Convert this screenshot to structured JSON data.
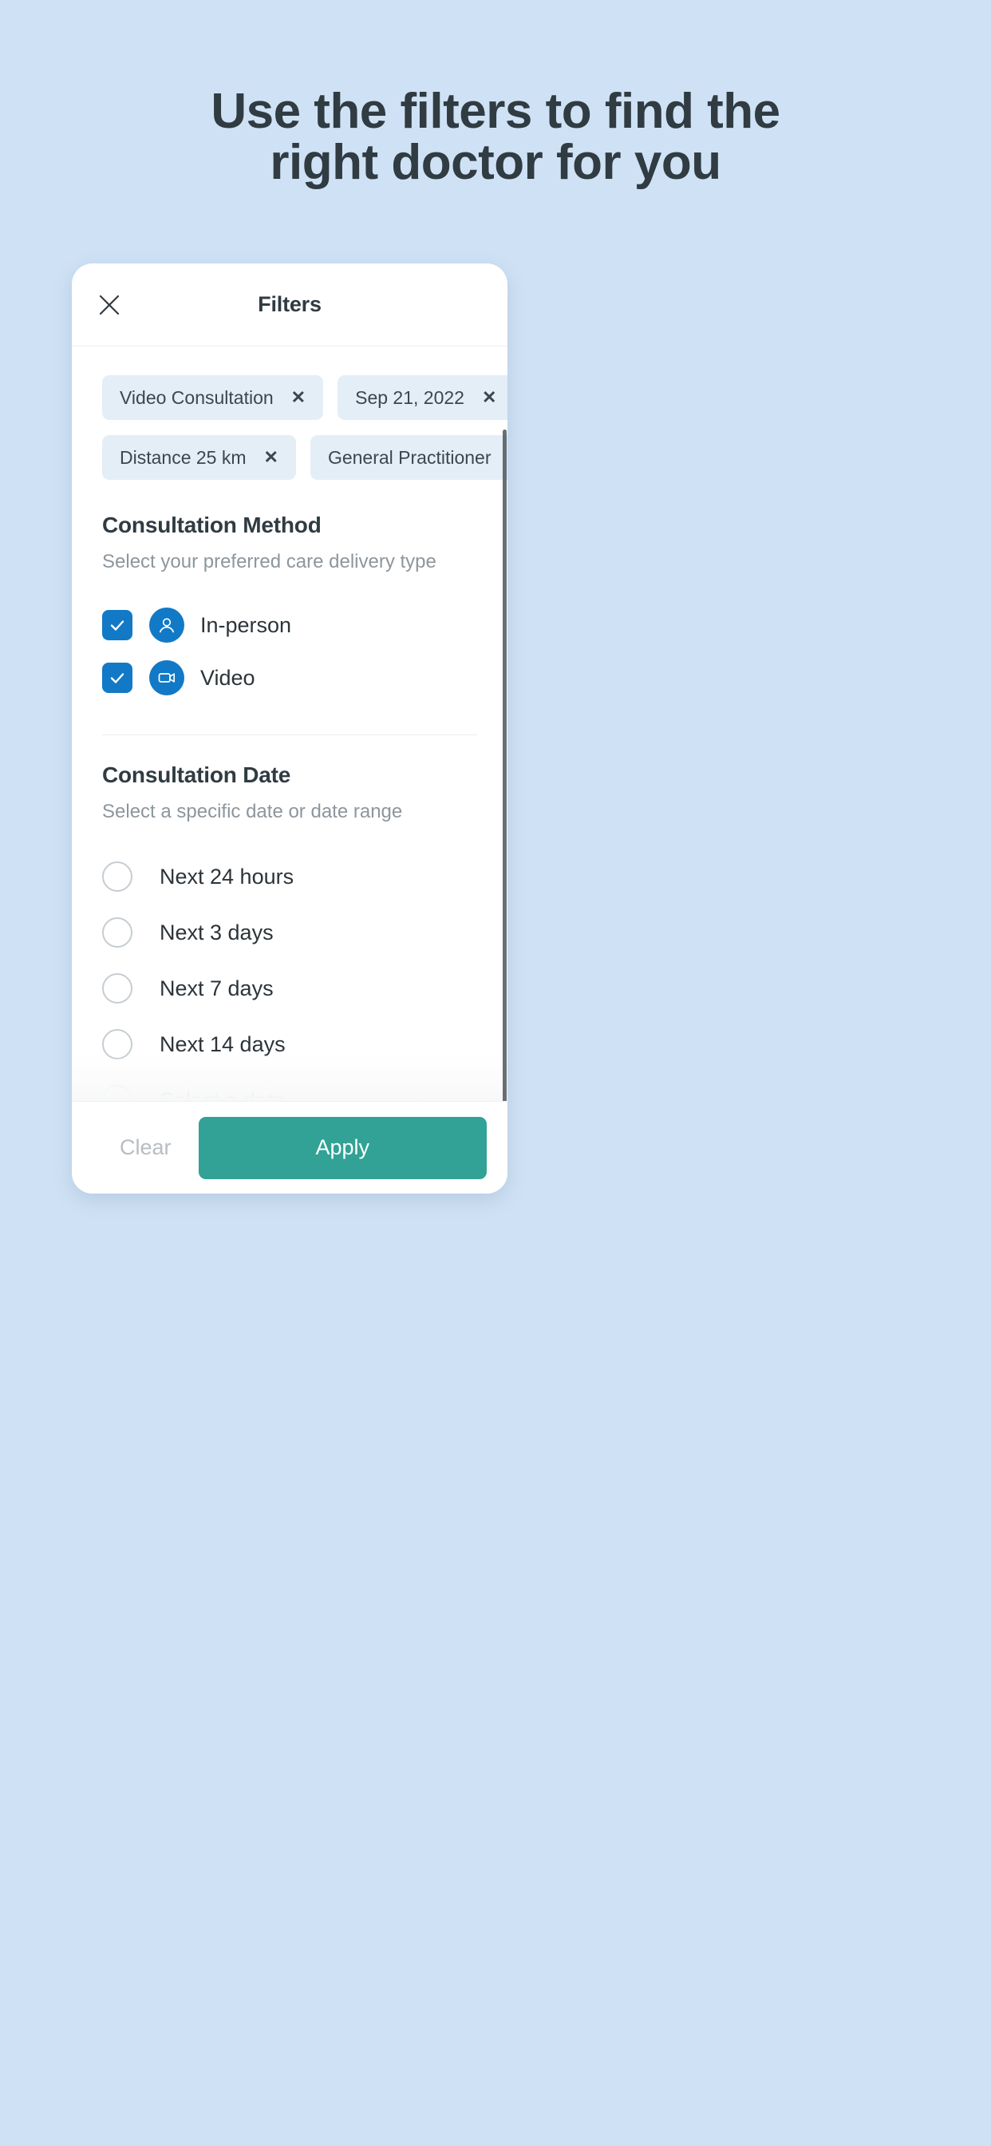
{
  "headline": {
    "line1": "Use the filters to find the",
    "line2": "right doctor for you"
  },
  "colors": {
    "page_background": "#cfe2f5",
    "headline_text": "#303b42",
    "chip_background": "#e4eef7",
    "accent_blue": "#1279c6",
    "apply_teal": "#31a295",
    "muted_text": "#8d969d"
  },
  "card": {
    "header": {
      "close_icon": "close-icon",
      "title": "Filters"
    },
    "chips": [
      [
        {
          "label": "Video Consultation",
          "remove_icon": "✕"
        },
        {
          "label": "Sep 21, 2022",
          "remove_icon": "✕"
        }
      ],
      [
        {
          "label": "Distance 25 km",
          "remove_icon": "✕"
        },
        {
          "label": "General Practitioner",
          "remove_icon": "✕"
        }
      ]
    ],
    "consultation_method": {
      "title": "Consultation Method",
      "subtitle": "Select your preferred care delivery type",
      "options": [
        {
          "label": "In-person",
          "icon": "person-icon",
          "checked": true
        },
        {
          "label": "Video",
          "icon": "video-camera-icon",
          "checked": true
        }
      ]
    },
    "consultation_date": {
      "title": "Consultation Date",
      "subtitle": "Select a specific date or date range",
      "options": [
        {
          "label": "Next 24 hours",
          "selected": false
        },
        {
          "label": "Next 3 days",
          "selected": false
        },
        {
          "label": "Next 7 days",
          "selected": false
        },
        {
          "label": "Next 14 days",
          "selected": false
        },
        {
          "label": "Select a date",
          "selected": false
        }
      ]
    },
    "footer": {
      "clear_label": "Clear",
      "apply_label": "Apply"
    }
  }
}
